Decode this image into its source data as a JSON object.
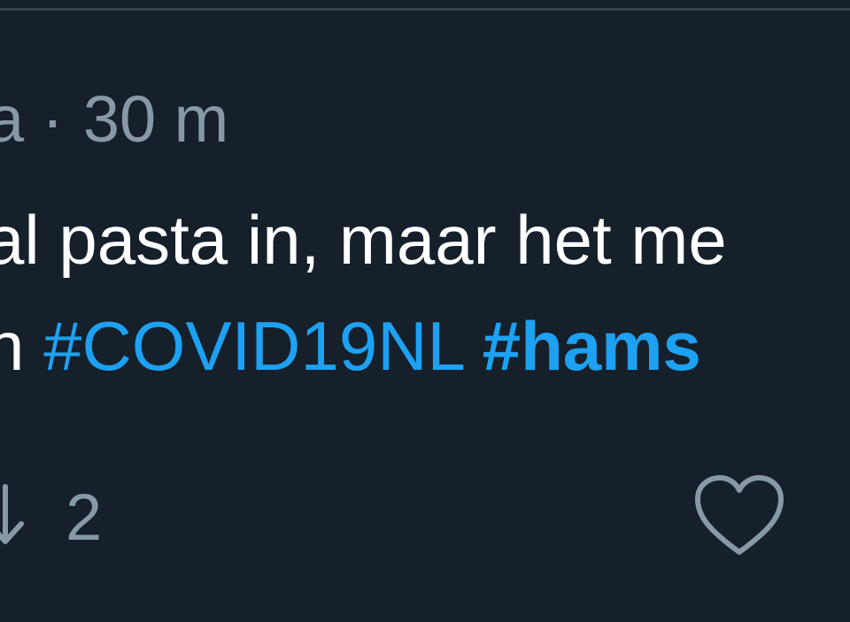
{
  "tweet": {
    "author_fragment": "a",
    "separator": "·",
    "timestamp": "30 m",
    "line1": "al pasta in, maar het me",
    "line2_prefix": "n ",
    "hashtags": [
      "#COVID19NL",
      "#hams"
    ]
  },
  "actions": {
    "retweet_icon": "retweet-icon",
    "retweet_count": "2",
    "like_icon": "heart-icon"
  },
  "colors": {
    "background": "#15202b",
    "text": "#ffffff",
    "muted": "#8899a6",
    "link": "#1da1f2",
    "border": "#38444d"
  }
}
